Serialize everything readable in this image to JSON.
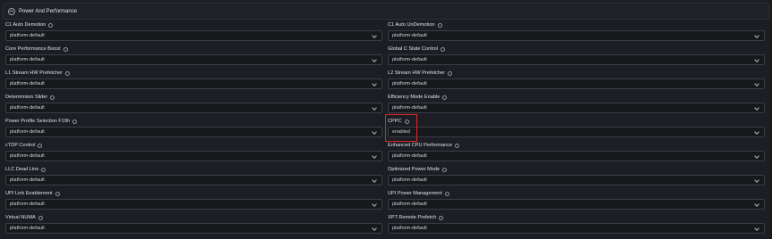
{
  "section": {
    "title": "Power And Performance"
  },
  "fields": [
    {
      "label": "C1 Auto Demotion",
      "value": "platform-default"
    },
    {
      "label": "C1 Auto UnDemotion",
      "value": "platform-default"
    },
    {
      "label": "Core Performance Boost",
      "value": "platform-default"
    },
    {
      "label": "Global C State Control",
      "value": "platform-default"
    },
    {
      "label": "L1 Stream HW Prefetcher",
      "value": "platform-default"
    },
    {
      "label": "L2 Stream HW Prefetcher",
      "value": "platform-default"
    },
    {
      "label": "Determinism Slider",
      "value": "platform-default"
    },
    {
      "label": "Efficiency Mode Enable",
      "value": "platform-default"
    },
    {
      "label": "Power Profile Selection F19h",
      "value": "platform-default"
    },
    {
      "label": "CPPC",
      "value": "enabled"
    },
    {
      "label": "cTDP Control",
      "value": "platform-default"
    },
    {
      "label": "Enhanced CPU Performance",
      "value": "platform-default"
    },
    {
      "label": "LLC Dead Line",
      "value": "platform-default"
    },
    {
      "label": "Optimized Power Mode",
      "value": "platform-default"
    },
    {
      "label": "UPI Link Enablement",
      "value": "platform-default"
    },
    {
      "label": "UPI Power Management",
      "value": "platform-default"
    },
    {
      "label": "Virtual NUMA",
      "value": "platform-default"
    },
    {
      "label": "XPT Remote Prefetch",
      "value": "platform-default"
    }
  ]
}
